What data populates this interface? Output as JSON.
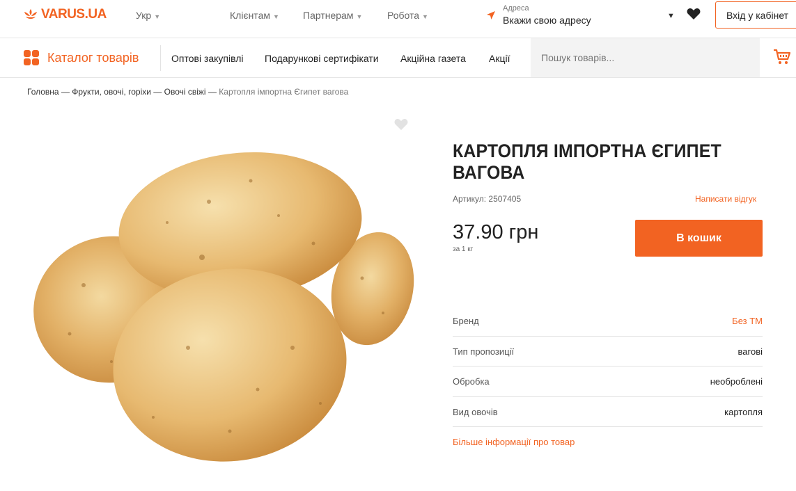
{
  "header": {
    "logo_text": "VARUS.UA",
    "language": "Укр",
    "nav": [
      "Клієнтам",
      "Партнерам",
      "Робота"
    ],
    "address_label": "Адреса",
    "address_value": "Вкажи свою адресу",
    "login_label": "Вхід у кабінет"
  },
  "catalog_bar": {
    "catalog_label": "Каталог товарів",
    "links": [
      "Оптові закупівлі",
      "Подарункові сертифікати",
      "Акційна газета",
      "Акції"
    ],
    "search_placeholder": "Пошук товарів..."
  },
  "breadcrumb": {
    "items": [
      "Головна",
      "Фрукти, овочі, горіхи",
      "Овочі свіжі"
    ],
    "separator": "—",
    "current": "Картопля імпортна Єгипет вагова"
  },
  "product": {
    "title": "КАРТОПЛЯ ІМПОРТНА ЄГИПЕТ ВАГОВА",
    "sku": "Артикул: 2507405",
    "review_link": "Написати відгук",
    "price": "37.90 грн",
    "unit": "за 1 кг",
    "buy_label": "В кошик",
    "attributes": [
      {
        "name": "Бренд",
        "value": "Без ТМ",
        "is_link": true
      },
      {
        "name": "Тип пропозиції",
        "value": "вагові",
        "is_link": false
      },
      {
        "name": "Обробка",
        "value": "необроблені",
        "is_link": false
      },
      {
        "name": "Вид овочів",
        "value": "картопля",
        "is_link": false
      }
    ],
    "more_info": "Більше інформації про товар"
  },
  "colors": {
    "accent": "#f26322",
    "text": "#222222",
    "muted": "#666666",
    "search_bg": "#f3f3f3"
  },
  "icons": [
    "logo-icon",
    "chevron-down-icon",
    "location-arrow-icon",
    "heart-icon",
    "catalog-grid-icon",
    "cart-icon",
    "favorite-heart-icon"
  ]
}
